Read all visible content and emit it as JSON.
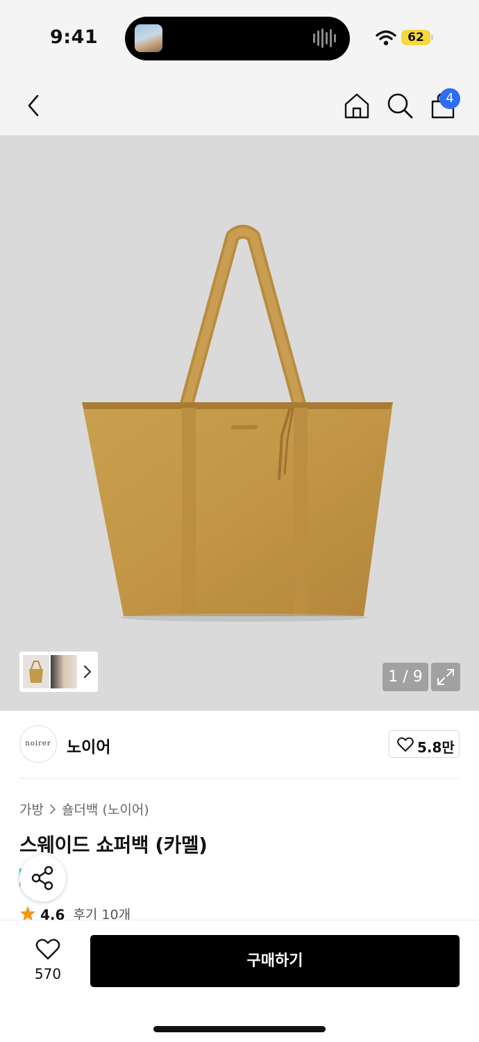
{
  "status_bar": {
    "time": "9:41",
    "battery": "62",
    "colors": {
      "battery": "#f7d83a"
    }
  },
  "nav": {
    "back_icon": "chevron-left-icon",
    "home_icon": "home-icon",
    "search_icon": "search-icon",
    "cart_icon": "shopping-bag-icon",
    "cart_badge": "4",
    "colors": {
      "badge": "#2f6df6"
    }
  },
  "gallery": {
    "page_indicator": "1 / 9",
    "expand_icon": "expand-icon"
  },
  "brand": {
    "logo_text": "noirer",
    "name": "노이어",
    "like_count": "5.8만"
  },
  "product": {
    "breadcrumb": [
      "가방",
      "숄더백 (노이어)"
    ],
    "title": "스웨이드 쇼퍼백 (카멜)",
    "rating": "4.6",
    "review_label": "후기 10개",
    "colors": {
      "star": "#f29a17",
      "bag": "#c4994a"
    }
  },
  "bottom_bar": {
    "wish_count": "570",
    "buy_label": "구매하기"
  }
}
